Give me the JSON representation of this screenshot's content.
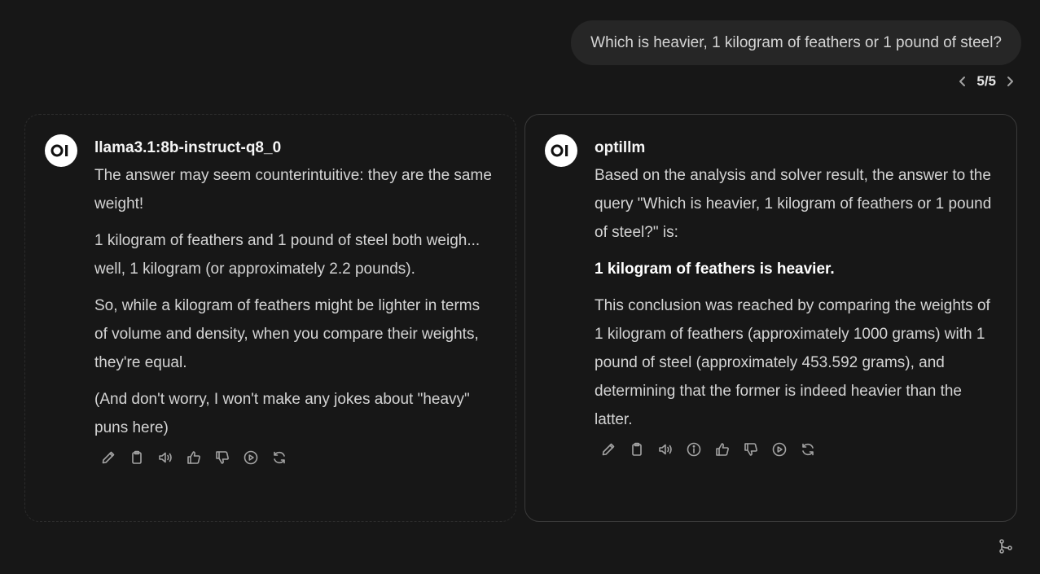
{
  "user_message": {
    "text": "Which is heavier, 1 kilogram of feathers or 1 pound of steel?"
  },
  "pager": {
    "label": "5/5",
    "prev_icon": "chevron-left-icon",
    "next_icon": "chevron-right-icon"
  },
  "responses": [
    {
      "model": "llama3.1:8b-instruct-q8_0",
      "avatar_icon": "openwebui-logo-icon",
      "paragraphs": [
        "The answer may seem counterintuitive: they are the same weight!",
        "1 kilogram of feathers and 1 pound of steel both weigh... well, 1 kilogram (or approximately 2.2 pounds).",
        "So, while a kilogram of feathers might be lighter in terms of volume and density, when you compare their weights, they're equal.",
        "(And don't worry, I won't make any jokes about \"heavy\" puns here)"
      ],
      "actions": [
        "edit-icon",
        "copy-icon",
        "read-aloud-icon",
        "thumbs-up-icon",
        "thumbs-down-icon",
        "continue-icon",
        "regenerate-icon"
      ]
    },
    {
      "model": "optillm",
      "avatar_icon": "openwebui-logo-icon",
      "paragraphs": [
        "Based on the analysis and solver result, the answer to the query \"Which is heavier, 1 kilogram of feathers or 1 pound of steel?\" is:",
        "1 kilogram of feathers is heavier.",
        "This conclusion was reached by comparing the weights of 1 kilogram of feathers (approximately 1000 grams) with 1 pound of steel (approximately 453.592 grams), and determining that the former is indeed heavier than the latter."
      ],
      "actions": [
        "edit-icon",
        "copy-icon",
        "read-aloud-icon",
        "info-icon",
        "thumbs-up-icon",
        "thumbs-down-icon",
        "continue-icon",
        "regenerate-icon"
      ]
    }
  ],
  "branch_icon": "merge-branch-icon",
  "colors": {
    "background": "#171717",
    "bubble": "#262626",
    "text": "#d4d4d4",
    "icon": "#a3a3a3"
  }
}
